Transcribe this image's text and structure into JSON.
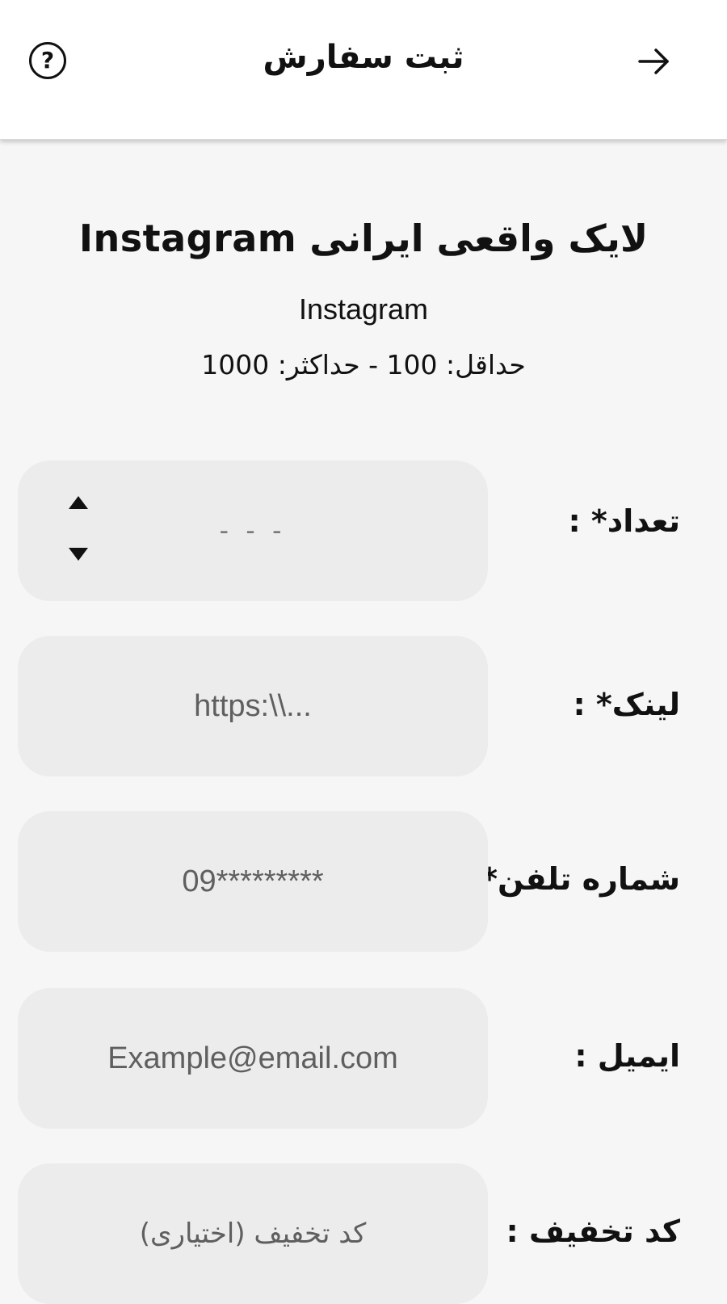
{
  "header": {
    "title": "ثبت سفارش",
    "help_icon": "help-circle-icon",
    "back_icon": "arrow-right-icon"
  },
  "service": {
    "title": "لایک واقعی ایرانی Instagram",
    "platform": "Instagram",
    "limits": "حداقل: 100 - حداکثر: 1000"
  },
  "form": {
    "quantity": {
      "label": "تعداد* :",
      "placeholder": "- - -",
      "increment_icon": "caret-up-icon",
      "decrement_icon": "caret-down-icon"
    },
    "link": {
      "label": "لینک* :",
      "placeholder": "https:\\\\..."
    },
    "phone": {
      "label": "شماره تلفن* :",
      "placeholder": "09*********"
    },
    "email": {
      "label": "ایمیل :",
      "placeholder": "Example@email.com"
    },
    "discount": {
      "label": "کد تخفیف :",
      "placeholder": "کد تخفیف (اختیاری)"
    }
  },
  "colors": {
    "background": "#f6f6f6",
    "appbar": "#ffffff",
    "field_background": "#ececec",
    "placeholder_text": "#5f5f5f",
    "text": "#111111"
  }
}
